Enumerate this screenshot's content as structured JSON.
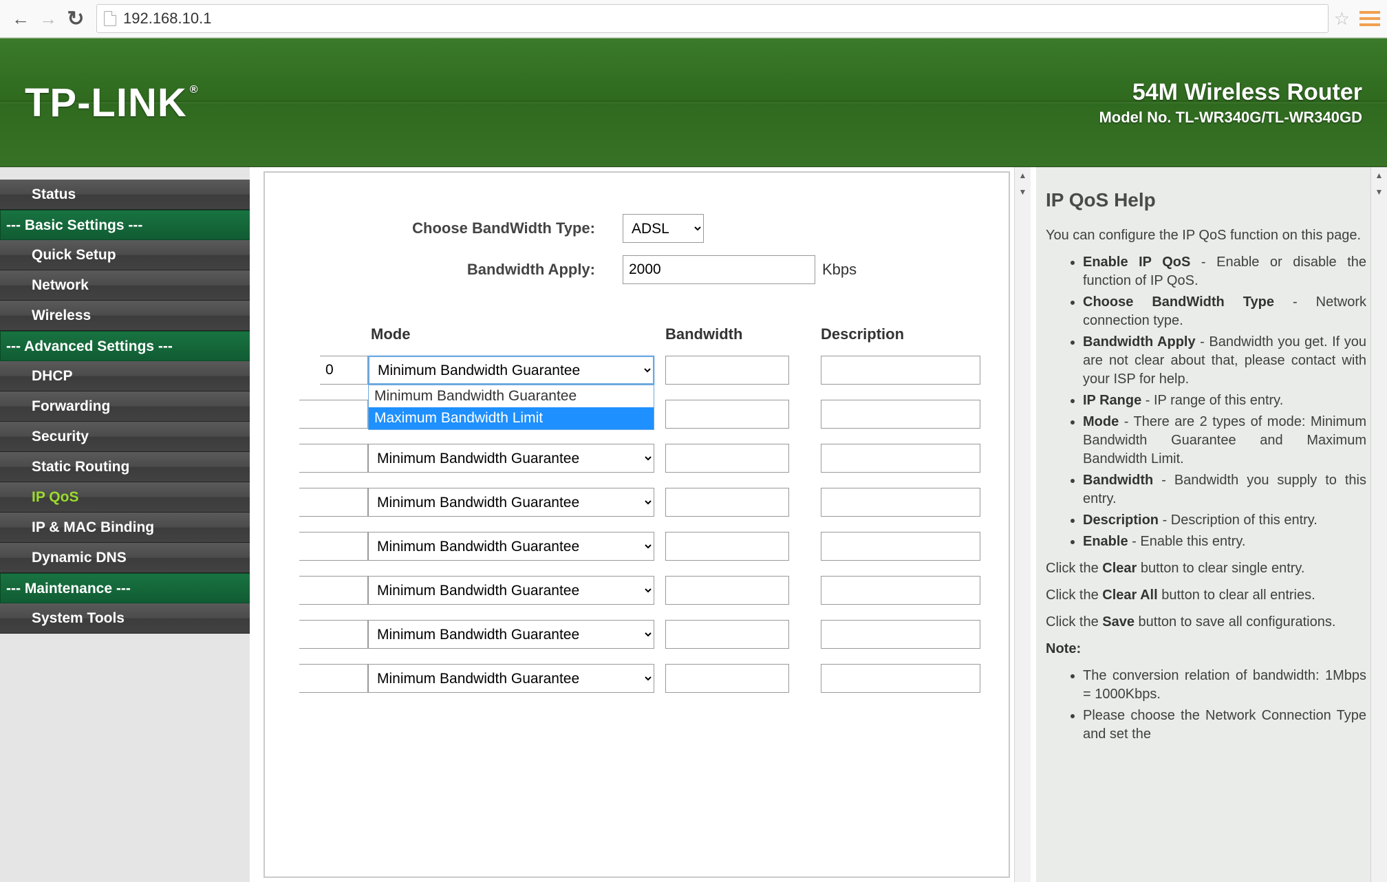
{
  "chrome": {
    "url": "192.168.10.1"
  },
  "banner": {
    "brand": "TP-LINK",
    "product_title": "54M Wireless Router",
    "product_model": "Model No. TL-WR340G/TL-WR340GD"
  },
  "sidebar": {
    "items": [
      {
        "label": "Status",
        "type": "item"
      },
      {
        "label": "--- Basic Settings ---",
        "type": "header"
      },
      {
        "label": "Quick Setup",
        "type": "item"
      },
      {
        "label": "Network",
        "type": "item"
      },
      {
        "label": "Wireless",
        "type": "item"
      },
      {
        "label": "--- Advanced Settings ---",
        "type": "header"
      },
      {
        "label": "DHCP",
        "type": "item"
      },
      {
        "label": "Forwarding",
        "type": "item"
      },
      {
        "label": "Security",
        "type": "item"
      },
      {
        "label": "Static Routing",
        "type": "item"
      },
      {
        "label": "IP QoS",
        "type": "item",
        "active": true
      },
      {
        "label": "IP & MAC Binding",
        "type": "item"
      },
      {
        "label": "Dynamic DNS",
        "type": "item"
      },
      {
        "label": "--- Maintenance ---",
        "type": "header"
      },
      {
        "label": "System Tools",
        "type": "item"
      }
    ]
  },
  "form": {
    "bandwidth_type_label": "Choose BandWidth Type:",
    "bandwidth_type_value": "ADSL",
    "bandwidth_apply_label": "Bandwidth Apply:",
    "bandwidth_apply_value": "2000",
    "bandwidth_apply_unit": "Kbps"
  },
  "columns": {
    "mode": "Mode",
    "bandwidth": "Bandwidth",
    "description": "Description"
  },
  "mode_options": [
    "Minimum Bandwidth Guarantee",
    "Maximum Bandwidth Limit"
  ],
  "rows": [
    {
      "hidden_value": "0",
      "mode": "Minimum Bandwidth Guarantee",
      "dropdown_open": true,
      "bandwidth": "",
      "description": ""
    },
    {
      "hidden_value": "",
      "mode": "",
      "bandwidth": "",
      "description": ""
    },
    {
      "hidden_value": "",
      "mode": "Minimum Bandwidth Guarantee",
      "bandwidth": "",
      "description": ""
    },
    {
      "hidden_value": "",
      "mode": "Minimum Bandwidth Guarantee",
      "bandwidth": "",
      "description": ""
    },
    {
      "hidden_value": "",
      "mode": "Minimum Bandwidth Guarantee",
      "bandwidth": "",
      "description": ""
    },
    {
      "hidden_value": "",
      "mode": "Minimum Bandwidth Guarantee",
      "bandwidth": "",
      "description": ""
    },
    {
      "hidden_value": "",
      "mode": "Minimum Bandwidth Guarantee",
      "bandwidth": "",
      "description": ""
    },
    {
      "hidden_value": "",
      "mode": "Minimum Bandwidth Guarantee",
      "bandwidth": "",
      "description": ""
    }
  ],
  "help": {
    "title": "IP QoS Help",
    "intro": "You can configure the IP QoS function on this page.",
    "bullets": [
      {
        "b": "Enable IP QoS",
        "t": " - Enable or disable the function of IP QoS."
      },
      {
        "b": "Choose BandWidth Type",
        "t": " - Network connection type."
      },
      {
        "b": "Bandwidth Apply",
        "t": " - Bandwidth you get. If you are not clear about that, please contact with your ISP for help."
      },
      {
        "b": "IP Range",
        "t": " - IP range of this entry."
      },
      {
        "b": "Mode",
        "t": " - There are 2 types of mode: Minimum Bandwidth Guarantee and Maximum Bandwidth Limit."
      },
      {
        "b": "Bandwidth",
        "t": " - Bandwidth you supply to this entry."
      },
      {
        "b": "Description",
        "t": " - Description of this entry."
      },
      {
        "b": "Enable",
        "t": " - Enable this entry."
      }
    ],
    "p_clear_a": "Click the ",
    "p_clear_b": "Clear",
    "p_clear_c": " button to clear single entry.",
    "p_clearall_a": "Click the ",
    "p_clearall_b": "Clear All",
    "p_clearall_c": " button to clear all entries.",
    "p_save_a": "Click the ",
    "p_save_b": "Save",
    "p_save_c": " button to save all configurations.",
    "note_label": "Note:",
    "notes": [
      "The conversion relation of bandwidth: 1Mbps = 1000Kbps.",
      "Please choose the Network Connection Type and set the"
    ]
  }
}
